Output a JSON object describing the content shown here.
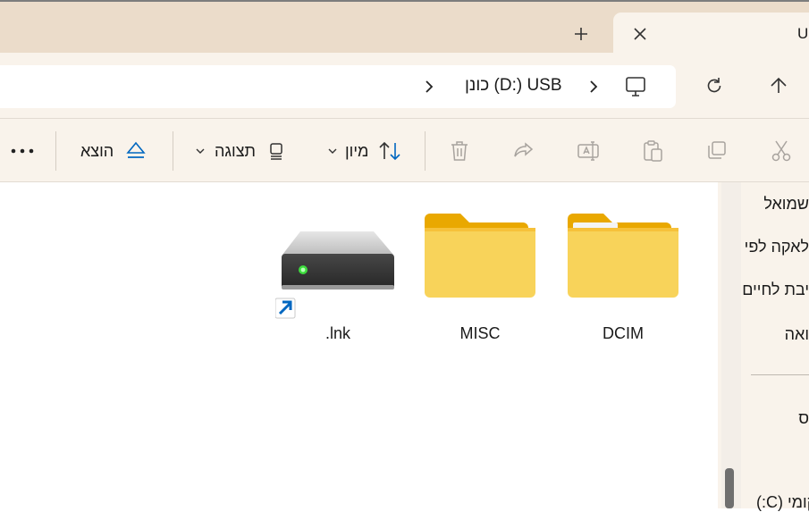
{
  "tabbar": {
    "tab_title": "U",
    "new_tab_icon": "plus-icon",
    "close_icon": "close-icon"
  },
  "address": {
    "path_text": "כונן (D:) USB",
    "chevron_icon": "chevron-right-icon",
    "pc_icon": "monitor-icon",
    "refresh_icon": "refresh-icon",
    "up_icon": "arrow-up-icon"
  },
  "toolbar": {
    "more_icon": "more-icon",
    "eject_label": "הוצא",
    "view_label": "תצוגה",
    "sort_label": "מיון",
    "icons": [
      "delete-icon",
      "share-icon",
      "rename-icon",
      "paste-icon",
      "copy-icon",
      "cut-icon"
    ]
  },
  "files": [
    {
      "name": ".lnk",
      "kind": "drive-shortcut"
    },
    {
      "name": "MISC",
      "kind": "folder"
    },
    {
      "name": "DCIM",
      "kind": "folder"
    }
  ],
  "sidebar": {
    "items": [
      "שמואל",
      "לאקה לפי",
      "יבת לחיים",
      "ואה",
      "ס",
      "קומי (C:)"
    ]
  },
  "colors": {
    "accent": "#0067c0",
    "folder": "#f8c537",
    "chrome": "#ebdcca"
  }
}
